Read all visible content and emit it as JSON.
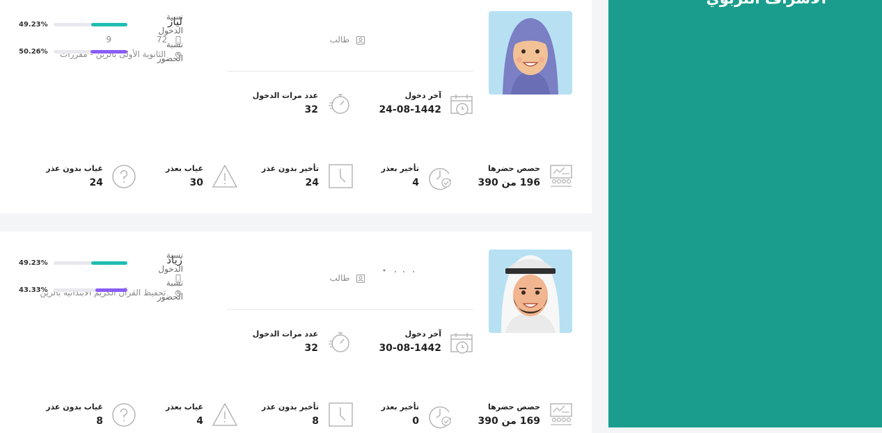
{
  "sidebar": {
    "title": "الاشراف التربوي"
  },
  "colors": {
    "sidebar": "#1a9d8c",
    "entry_bar": "#1fbdb2",
    "attendance_bar": "#8b5cf6"
  },
  "labels": {
    "last_login": "آخر دخول",
    "login_count": "عدد مرات الدخول",
    "attended": "حصص حضرها",
    "late_excused": "تأخير بعذر",
    "late_unexcused": "تأخير بدون عذر",
    "absent_excused": "غياب بعذر",
    "absent_unexcused": "غياب بدون عذر",
    "entry_ratio": "نسبة الدخول",
    "attendance_ratio": "نسبة الحضور"
  },
  "students": [
    {
      "name": "لياز",
      "phone": "72",
      "phone_extra": "9",
      "role": "طالب",
      "school": "الثانوية الأولى بالرين - مقررات",
      "last_login": "24-08-1442",
      "login_count": "32",
      "attended": "196 من 390",
      "late_excused": "4",
      "late_unexcused": "24",
      "absent_excused": "30",
      "absent_unexcused": "24",
      "entry_pct": "49.23%",
      "entry_value": 49.23,
      "attendance_pct": "50.26%",
      "attendance_value": 50.26
    },
    {
      "name": "زياد",
      "phone": "",
      "phone_extra": "",
      "role": "طالب",
      "school": "تحفيظ القرآن الكريم الابتدائية بالرين",
      "last_login": "30-08-1442",
      "login_count": "32",
      "attended": "169 من 390",
      "late_excused": "0",
      "late_unexcused": "8",
      "absent_excused": "4",
      "absent_unexcused": "8",
      "entry_pct": "49.23%",
      "entry_value": 49.23,
      "attendance_pct": "43.33%",
      "attendance_value": 43.33
    }
  ]
}
